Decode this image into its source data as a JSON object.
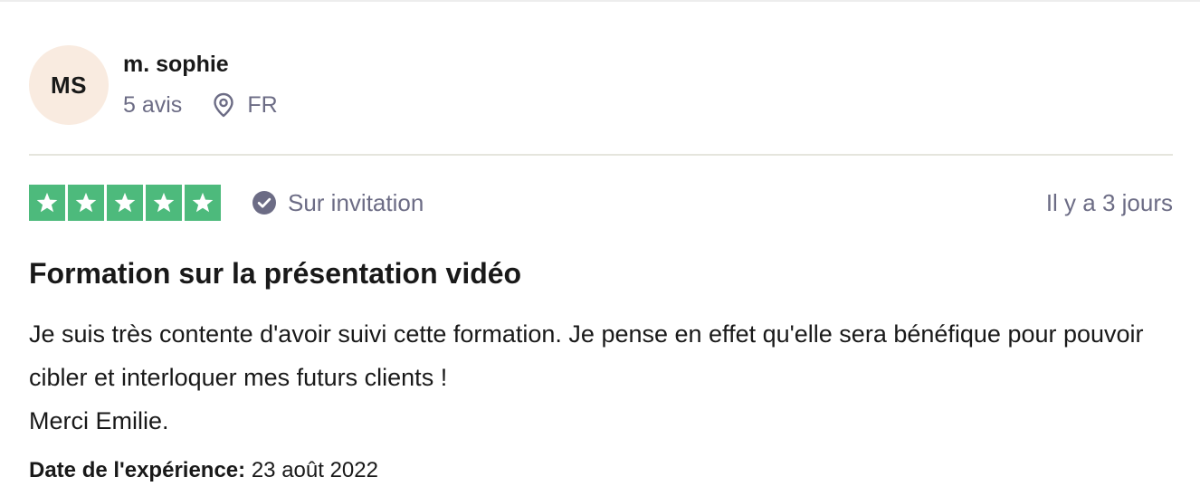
{
  "consumer": {
    "initials": "MS",
    "name": "m. sophie",
    "review_count": "5 avis",
    "country": "FR",
    "avatar_color": "#f9ebe0"
  },
  "review": {
    "stars": 5,
    "star_color": "#4dba7c",
    "verification": "Sur invitation",
    "relative_date": "Il y a 3 jours",
    "title": "Formation sur la présentation vidéo",
    "body_lines": [
      "Je suis très contente d'avoir suivi cette formation. Je pense en effet qu'elle sera bénéfique pour pouvoir cibler et interloquer mes futurs clients !",
      "Merci Emilie."
    ],
    "experience_label": "Date de l'expérience:",
    "experience_date": "23 août 2022"
  },
  "icons": {
    "location": "location-pin-icon",
    "verified": "check-circle-icon",
    "star": "star-icon"
  },
  "colors": {
    "muted_text": "#6c6c85",
    "primary_text": "#191919"
  }
}
